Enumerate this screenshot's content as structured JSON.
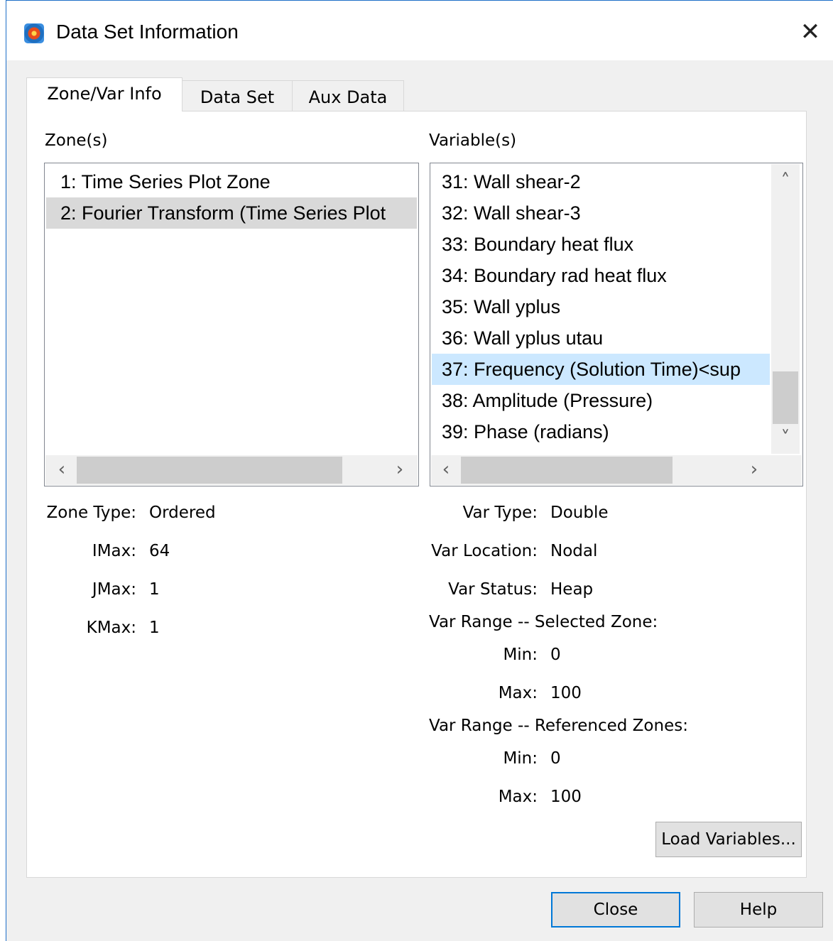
{
  "window": {
    "title": "Data Set Information",
    "icon": "tecplot-app-icon"
  },
  "tabs": [
    {
      "label": "Zone/Var Info",
      "active": true
    },
    {
      "label": "Data Set",
      "active": false
    },
    {
      "label": "Aux Data",
      "active": false
    }
  ],
  "zones": {
    "label": "Zone(s)",
    "items": [
      "1: Time Series Plot Zone",
      "2: Fourier Transform (Time Series Plot"
    ],
    "selected_index": 1
  },
  "variables": {
    "label": "Variable(s)",
    "items": [
      "31: Wall shear-2",
      "32: Wall shear-3",
      "33: Boundary heat flux",
      "34: Boundary rad heat flux",
      "35: Wall yplus",
      "36: Wall yplus utau",
      "37: Frequency (Solution Time)<sup",
      "38: Amplitude (Pressure)",
      "39: Phase (radians)"
    ],
    "selected_index": 6
  },
  "zone_info": {
    "zone_type_label": "Zone Type:",
    "zone_type": "Ordered",
    "imax_label": "IMax:",
    "imax": "64",
    "jmax_label": "JMax:",
    "jmax": "1",
    "kmax_label": "KMax:",
    "kmax": "1"
  },
  "var_info": {
    "var_type_label": "Var Type:",
    "var_type": "Double",
    "var_location_label": "Var Location:",
    "var_location": "Nodal",
    "var_status_label": "Var Status:",
    "var_status": "Heap",
    "range_selected_header": "Var Range -- Selected Zone:",
    "selected_min_label": "Min:",
    "selected_min": "0",
    "selected_max_label": "Max:",
    "selected_max": "100",
    "range_referenced_header": "Var Range -- Referenced Zones:",
    "referenced_min_label": "Min:",
    "referenced_min": "0",
    "referenced_max_label": "Max:",
    "referenced_max": "100"
  },
  "buttons": {
    "load_variables": "Load Variables...",
    "close": "Close",
    "help": "Help"
  }
}
